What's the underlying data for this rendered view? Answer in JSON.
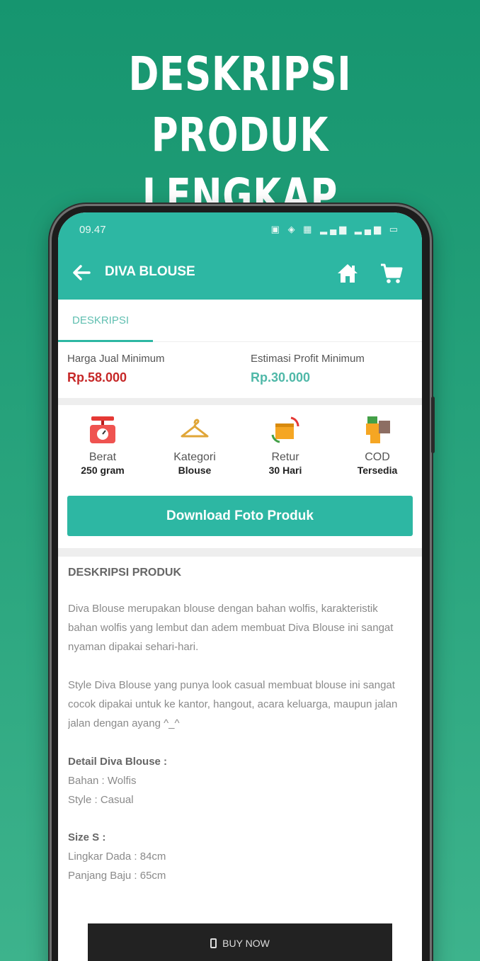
{
  "headline": {
    "line1": "DESKRIPSI PRODUK",
    "line2": "LENGKAP"
  },
  "status_bar": {
    "time": "09.47",
    "icons": "▣ ◈ ▦ ▂▄▆ ▂▄▆ ▭"
  },
  "app_bar": {
    "title": "DIVA BLOUSE",
    "back_icon": "arrow-left-icon",
    "home_icon": "home-icon",
    "cart_icon": "cart-icon"
  },
  "tabs": [
    {
      "label": "DESKRIPSI",
      "active": true
    }
  ],
  "prices": {
    "min_price_label": "Harga Jual Minimum",
    "min_price_value": "Rp.58.000",
    "profit_label": "Estimasi Profit Minimum",
    "profit_value": "Rp.30.000"
  },
  "info_items": [
    {
      "label": "Berat",
      "value": "250 gram",
      "icon": "scale-icon"
    },
    {
      "label": "Kategori",
      "value": "Blouse",
      "icon": "hanger-icon"
    },
    {
      "label": "Retur",
      "value": "30 Hari",
      "icon": "return-box-icon"
    },
    {
      "label": "COD",
      "value": "Tersedia",
      "icon": "cod-cash-icon"
    }
  ],
  "download_button": "Download Foto Produk",
  "description": {
    "title": "DESKRIPSI PRODUK",
    "para1": "Diva Blouse merupakan blouse dengan bahan wolfis, karakteristik bahan wolfis yang lembut dan adem membuat Diva Blouse ini sangat nyaman dipakai sehari-hari.",
    "para2": "Style Diva Blouse yang punya look casual membuat blouse ini sangat cocok dipakai untuk ke kantor, hangout, acara keluarga, maupun jalan jalan dengan ayang ^_^",
    "detail_title": "Detail Diva Blouse :",
    "detail_bahan": "Bahan : Wolfis",
    "detail_style": "Style : Casual",
    "size_title": "Size S :",
    "size_dada": "Lingkar Dada : 84cm",
    "size_panjang": "Panjang Baju : 65cm"
  },
  "buy_button": "BUY NOW",
  "colors": {
    "accent": "#2db7a3",
    "price_red": "#c62828",
    "profit_teal": "#4fb8a8",
    "background": "#16956f"
  }
}
